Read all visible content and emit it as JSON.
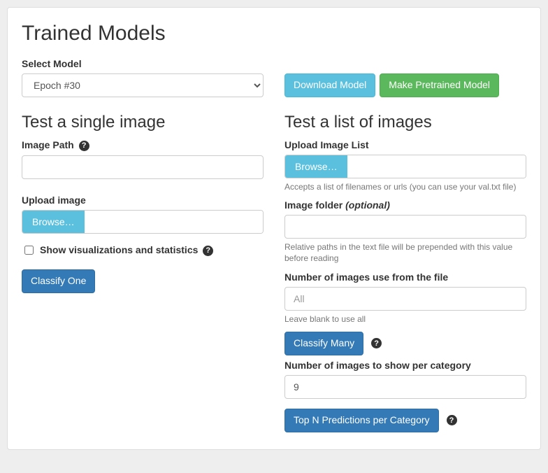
{
  "header": {
    "title": "Trained Models",
    "select_label": "Select Model",
    "selected_model": "Epoch #30",
    "download_btn": "Download Model",
    "pretrained_btn": "Make Pretrained Model"
  },
  "single": {
    "heading": "Test a single image",
    "image_path_label": "Image Path",
    "upload_label": "Upload image",
    "browse_label": "Browse…",
    "show_viz_label": "Show visualizations and statistics",
    "classify_btn": "Classify One"
  },
  "list": {
    "heading": "Test a list of images",
    "upload_list_label": "Upload Image List",
    "browse_label": "Browse…",
    "upload_help": "Accepts a list of filenames or urls (you can use your val.txt file)",
    "folder_label": "Image folder",
    "folder_optional": "(optional)",
    "folder_help": "Relative paths in the text file will be prepended with this value before reading",
    "num_use_label": "Number of images use from the file",
    "num_use_placeholder": "All",
    "num_use_help": "Leave blank to use all",
    "classify_many_btn": "Classify Many",
    "per_category_label": "Number of images to show per category",
    "per_category_value": "9",
    "topn_btn": "Top N Predictions per Category"
  }
}
